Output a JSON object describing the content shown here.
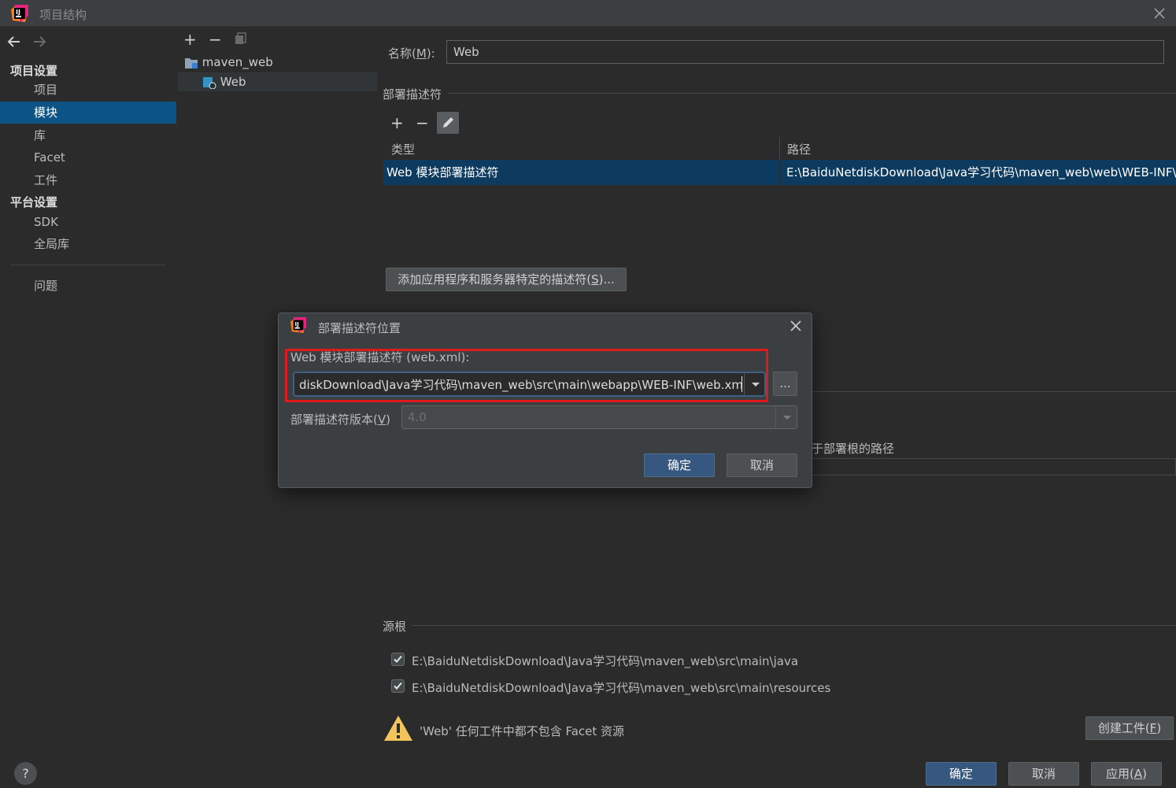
{
  "window": {
    "title": "项目结构",
    "app_icon": "intellij-icon"
  },
  "nav": {
    "project_settings_header": "项目设置",
    "project_items": [
      "项目",
      "模块",
      "库",
      "Facet",
      "工件"
    ],
    "selected": "模块",
    "platform_settings_header": "平台设置",
    "platform_items": [
      "SDK",
      "全局库"
    ],
    "problems": "问题"
  },
  "tree": {
    "toolbar": {
      "add": "+",
      "remove": "−"
    },
    "root": "maven_web",
    "child": "Web"
  },
  "main": {
    "name_label": "名称(",
    "name_mnemonic": "M",
    "name_label_end": "):",
    "name_value": "Web",
    "deploy_section": "部署描述符",
    "table": {
      "col_type": "类型",
      "col_path": "路径",
      "row_type": "Web 模块部署描述符",
      "row_path": "E:\\BaiduNetdiskDownload\\Java学习代码\\maven_web\\web\\WEB-INF\\web.xml"
    },
    "add_descriptor_button": "添加应用程序和服务器特定的描述符(",
    "add_descriptor_mnemonic": "S",
    "add_descriptor_end": ")...",
    "partial_relative_path": "于部署根的路径",
    "source_roots_section": "源根",
    "source_roots": [
      "E:\\BaiduNetdiskDownload\\Java学习代码\\maven_web\\src\\main\\java",
      "E:\\BaiduNetdiskDownload\\Java学习代码\\maven_web\\src\\main\\resources"
    ],
    "warning_text": "'Web' 任何工件中都不包含 Facet 资源",
    "create_artifact_button": "创建工件(",
    "create_artifact_mnemonic": "F",
    "create_artifact_end": ")"
  },
  "footer": {
    "help": "?",
    "ok": "确定",
    "cancel": "取消",
    "apply": "应用(",
    "apply_mnemonic": "A",
    "apply_end": ")"
  },
  "dialog": {
    "title": "部署描述符位置",
    "descriptor_label": "Web 模块部署描述符 (web.xml):",
    "descriptor_value": "diskDownload\\Java学习代码\\maven_web\\src\\main\\webapp\\WEB-INF\\web.xml",
    "browse": "...",
    "version_label": "部署描述符版本(",
    "version_mnemonic": "V",
    "version_label_end": ")",
    "version_value": "4.0",
    "ok": "确定",
    "cancel": "取消"
  },
  "colors": {
    "highlight_box": "#e0191a",
    "selection": "#0d3a5f",
    "primary_button": "#365880"
  }
}
